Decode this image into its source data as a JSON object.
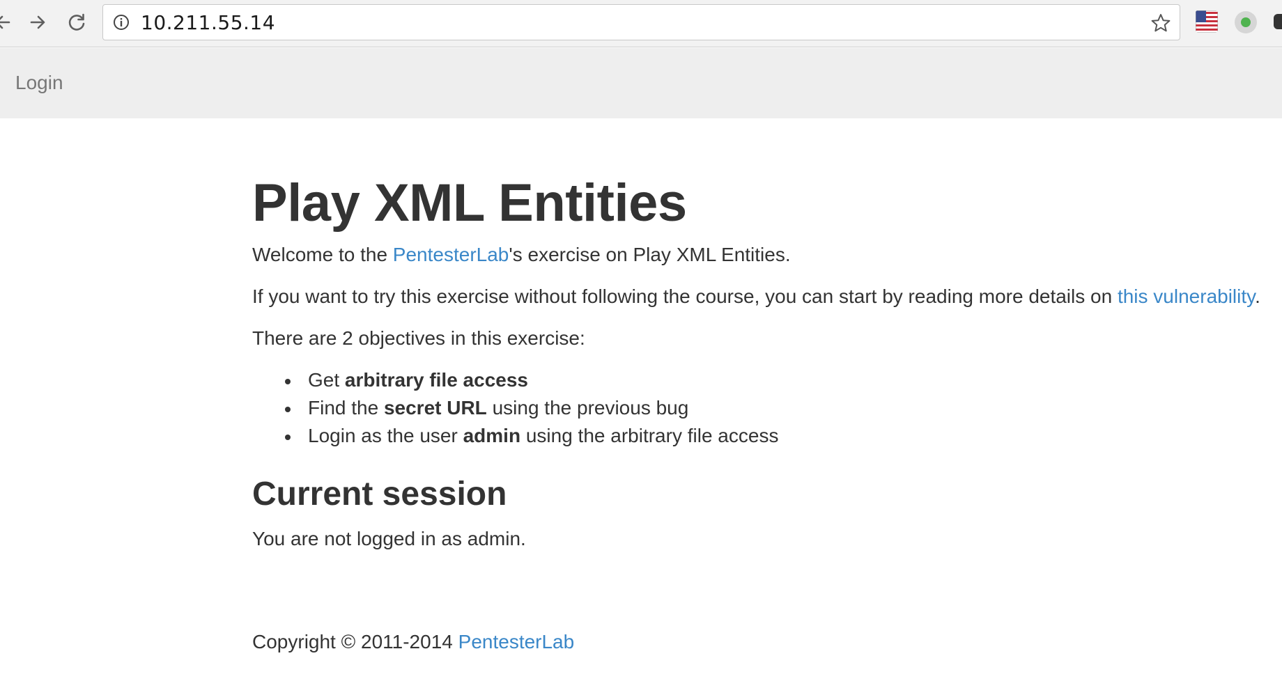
{
  "browser": {
    "address": "10.211.55.14",
    "icons": {
      "back": "back-arrow-icon",
      "forward": "forward-arrow-icon",
      "reload": "reload-icon",
      "info": "info-icon",
      "bookmark": "star-icon",
      "flag": "us-flag-icon",
      "extension": "green-dot-extension-icon"
    }
  },
  "navbar": {
    "login_label": "Login"
  },
  "main": {
    "title": "Play XML Entities",
    "welcome": {
      "prefix": "Welcome to the ",
      "link": "PentesterLab",
      "suffix": "'s exercise on Play XML Entities."
    },
    "intro": {
      "prefix": "If you want to try this exercise without following the course, you can start by reading more details on ",
      "link": "this vulnerability",
      "suffix": "."
    },
    "objectives_intro": "There are 2 objectives in this exercise:",
    "objectives": [
      {
        "before": "Get ",
        "bold": "arbitrary file access",
        "after": ""
      },
      {
        "before": "Find the ",
        "bold": "secret URL",
        "after": " using the previous bug"
      },
      {
        "before": "Login as the user ",
        "bold": "admin",
        "after": " using the arbitrary file access"
      }
    ],
    "session_title": "Current session",
    "session_status": "You are not logged in as admin."
  },
  "footer": {
    "prefix": "Copyright © 2011-2014 ",
    "link": "PentesterLab"
  },
  "colors": {
    "link": "#3a87c8",
    "text": "#333333",
    "navbar_bg": "#eeeeee",
    "navbar_text": "#777777"
  }
}
